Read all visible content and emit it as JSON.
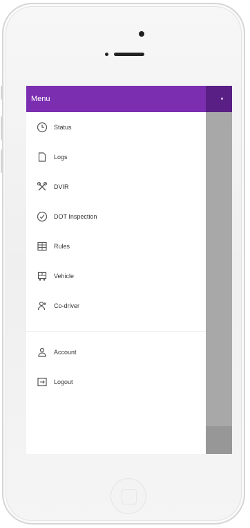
{
  "app": {
    "menu_title": "Menu"
  },
  "menu": {
    "items": [
      {
        "label": "Status",
        "icon": "clock-icon"
      },
      {
        "label": "Logs",
        "icon": "document-icon"
      },
      {
        "label": "DVIR",
        "icon": "tools-icon"
      },
      {
        "label": "DOT Inspection",
        "icon": "check-circle-icon"
      },
      {
        "label": "Rules",
        "icon": "rules-icon"
      },
      {
        "label": "Vehicle",
        "icon": "truck-icon"
      },
      {
        "label": "Co-driver",
        "icon": "user-plus-icon"
      }
    ],
    "secondary": [
      {
        "label": "Account",
        "icon": "account-icon"
      },
      {
        "label": "Logout",
        "icon": "logout-icon"
      }
    ]
  },
  "colors": {
    "accent": "#7b2fb0",
    "accent_dark": "#5a1f84",
    "scrim": "#a8a8a8"
  }
}
